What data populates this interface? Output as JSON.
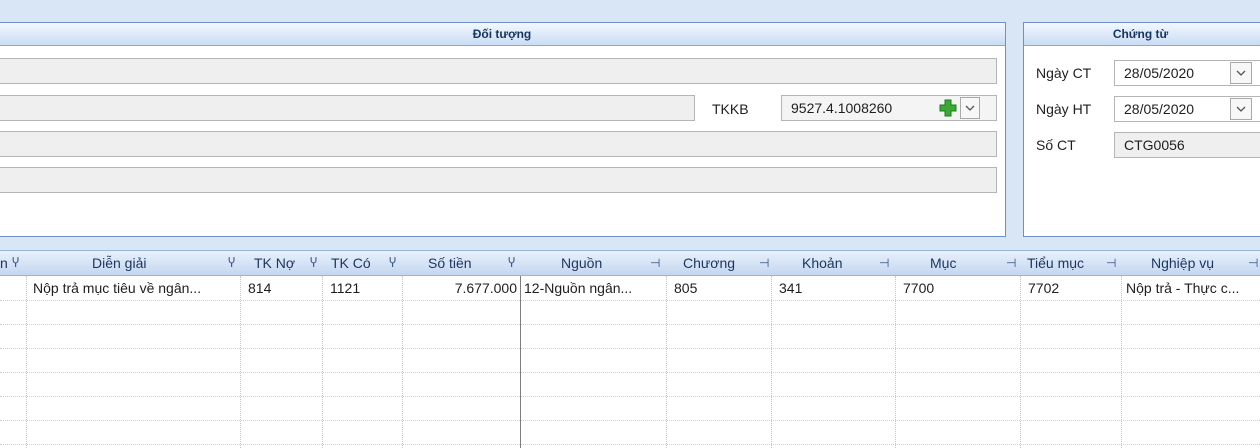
{
  "doi_tuong": {
    "title": "Đối tượng",
    "fields": [
      "",
      "",
      "",
      ""
    ],
    "tkkb_label": "TKKB",
    "tkkb_value": "9527.4.1008260"
  },
  "chung_tu": {
    "title": "Chứng từ",
    "ngay_ct_label": "Ngày CT",
    "ngay_ct_value": "28/05/2020",
    "ngay_ht_label": "Ngày HT",
    "ngay_ht_value": "28/05/2020",
    "so_ct_label": "Số CT",
    "so_ct_value": "CTG0056"
  },
  "grid": {
    "columns": [
      "n",
      "Diễn giải",
      "TK Nợ",
      "TK Có",
      "Số tiền",
      "Nguồn",
      "Chương",
      "Khoản",
      "Mục",
      "Tiểu mục",
      "Nghiệp vụ"
    ],
    "rows": [
      [
        "",
        "Nộp trả mục tiêu về ngân...",
        "814",
        "1121",
        "7.677.000",
        "12-Nguồn ngân...",
        "805",
        "341",
        "7700",
        "7702",
        "Nộp trả - Thực c..."
      ]
    ]
  },
  "icons": {
    "pin": "pin-icon",
    "add": "add-icon",
    "dropdown": "chevron-down-icon"
  },
  "colors": {
    "accent_border": "#6f8fc8",
    "background": "#d9e6f5",
    "add_green": "#3aa935"
  }
}
